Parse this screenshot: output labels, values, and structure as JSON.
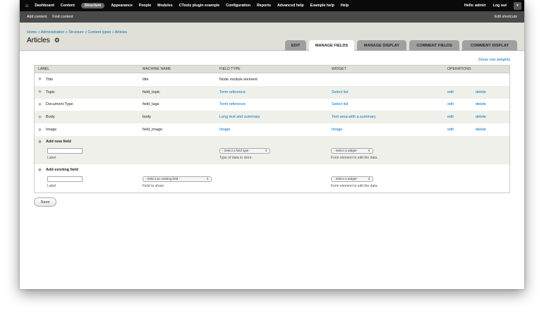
{
  "toolbar": {
    "menu": [
      "Dashboard",
      "Content",
      "Structure",
      "Appearance",
      "People",
      "Modules",
      "CTools plugin example",
      "Configuration",
      "Reports",
      "Advanced help",
      "Example help",
      "Help"
    ],
    "hello": "Hello",
    "username": "admin",
    "logout": "Log out",
    "shortcuts": [
      "Add content",
      "Find content"
    ],
    "edit_shortcuts": "Edit shortcuts"
  },
  "header": {
    "breadcrumb": "Home » Administration » Structure » Content types » Articles",
    "title": "Articles",
    "tabs": [
      "EDIT",
      "MANAGE FIELDS",
      "MANAGE DISPLAY",
      "COMMENT FIELDS",
      "COMMENT DISPLAY"
    ]
  },
  "content": {
    "show_row_weights": "Show row weights",
    "columns": [
      "LABEL",
      "MACHINE NAME",
      "FIELD TYPE",
      "WIDGET",
      "OPERATIONS"
    ],
    "rows": [
      {
        "label": "Title",
        "machine": "title",
        "type": "Node module element",
        "widget": "",
        "edit": "",
        "delete": ""
      },
      {
        "label": "Topic",
        "machine": "field_topic",
        "type": "Term reference",
        "widget": "Select list",
        "edit": "edit",
        "delete": "delete"
      },
      {
        "label": "Document Type",
        "machine": "field_tags",
        "type": "Term reference",
        "widget": "Select list",
        "edit": "edit",
        "delete": "delete"
      },
      {
        "label": "Body",
        "machine": "body",
        "type": "Long text and summary",
        "widget": "Text area with a summary",
        "edit": "edit",
        "delete": "delete"
      },
      {
        "label": "Image",
        "machine": "field_image",
        "type": "Image",
        "widget": "Image",
        "edit": "edit",
        "delete": "delete"
      }
    ],
    "add_new": {
      "title": "Add new field",
      "label_desc": "Label",
      "type_select": "- Select a field type -",
      "type_desc": "Type of data to store.",
      "widget_select": "- Select a widget -",
      "widget_desc": "Form element to edit the data."
    },
    "add_existing": {
      "title": "Add existing field",
      "label_desc": "Label",
      "field_select": "- Select an existing field -",
      "field_desc": "Field to share",
      "widget_select": "- Select a widget -",
      "widget_desc": "Form element to edit the data."
    },
    "save": "Save"
  }
}
